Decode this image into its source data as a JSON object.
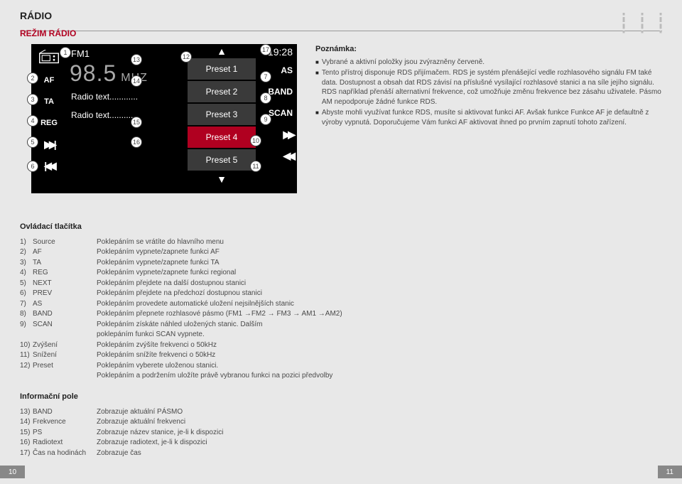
{
  "header": {
    "title": "RÁDIO"
  },
  "section": {
    "mode_title": "REŽIM RÁDIO"
  },
  "radio": {
    "band": "FM1",
    "frequency": "98.5",
    "unit": "MHZ",
    "time": "19:28",
    "af": "AF",
    "ta": "TA",
    "reg": "REG",
    "as": "AS",
    "band_btn": "BAND",
    "scan": "SCAN",
    "radiotext1": "Radio text............",
    "radiotext2": "Radio text............",
    "presets": [
      "Preset 1",
      "Preset 2",
      "Preset 3",
      "Preset 4",
      "Preset 5"
    ]
  },
  "callouts": [
    "1",
    "2",
    "3",
    "4",
    "5",
    "6",
    "7",
    "8",
    "9",
    "10",
    "11",
    "12",
    "13",
    "14",
    "15",
    "16",
    "17"
  ],
  "notes": {
    "title": "Poznámka:",
    "items": [
      "Vybrané a aktivní položky jsou zvýrazněny červeně.",
      "Tento přístroj disponuje RDS přijímačem. RDS je systém přenášející vedle rozhlasového signálu FM také data. Dostupnost a obsah dat RDS závisí na příslušné vysílající rozhlasové stanici a na síle jejího signálu. RDS například přenáší alternativní frekvence, což umožňuje změnu frekvence bez zásahu uživatele. Pásmo AM nepodporuje žádné funkce RDS.",
      "Abyste mohli využívat funkce RDS, musíte si aktivovat funkci AF. Avšak funkce Funkce AF je defaultně z výroby vypnutá. Doporučujeme Vám funkci AF aktivovat ihned po prvním zapnutí tohoto zařízení."
    ]
  },
  "controls": {
    "title": "Ovládací tlačítka",
    "rows": [
      {
        "n": "1)",
        "name": "Source",
        "desc": "Poklepáním se vrátíte do hlavního menu"
      },
      {
        "n": "2)",
        "name": "AF",
        "desc": "Poklepáním vypnete/zapnete funkci AF"
      },
      {
        "n": "3)",
        "name": "TA",
        "desc": "Poklepáním vypnete/zapnete funkci TA"
      },
      {
        "n": "4)",
        "name": "REG",
        "desc": "Poklepáním vypnete/zapnete funkci regional"
      },
      {
        "n": "5)",
        "name": "NEXT",
        "desc": "Poklepáním přejdete na další dostupnou stanici"
      },
      {
        "n": "6)",
        "name": "PREV",
        "desc": "Poklepáním přejdete na předchozí dostupnou stanici"
      },
      {
        "n": "7)",
        "name": "AS",
        "desc": "Poklepáním provedete automatické uložení nejsilnějších stanic"
      },
      {
        "n": "8)",
        "name": "BAND",
        "desc": "Poklepáním přepnete rozhlasové pásmo (FM1 →FM2 → FM3 → AM1 →AM2)"
      },
      {
        "n": "9)",
        "name": "SCAN",
        "desc": "Poklepáním získáte náhled uložených stanic. Dalším"
      },
      {
        "n": "",
        "name": "",
        "desc": "poklepáním funkci SCAN vypnete."
      },
      {
        "n": "10)",
        "name": "Zvýšení",
        "desc": "Poklepáním zvýšíte frekvenci o 50kHz"
      },
      {
        "n": "11)",
        "name": "Snížení",
        "desc": "Poklepáním snížíte frekvenci o 50kHz"
      },
      {
        "n": "12)",
        "name": "Preset",
        "desc": "Poklepáním vyberete uloženou stanici."
      },
      {
        "n": "",
        "name": "",
        "desc": "Poklepáním a podržením uložíte právě vybranou funkci na pozici předvolby"
      }
    ]
  },
  "info": {
    "title": "Informační pole",
    "rows": [
      {
        "n": "13)",
        "name": "BAND",
        "desc": "Zobrazuje aktuální PÁSMO"
      },
      {
        "n": "14)",
        "name": "Frekvence",
        "desc": "Zobrazuje aktuální frekvenci"
      },
      {
        "n": "15)",
        "name": "PS",
        "desc": "Zobrazuje název stanice, je-li k dispozici"
      },
      {
        "n": "16)",
        "name": "Radiotext",
        "desc": "Zobrazuje radiotext, je-li k dispozici"
      },
      {
        "n": "17)",
        "name": "Čas na hodinách",
        "desc": "Zobrazuje čas"
      }
    ]
  },
  "pagenum": {
    "left": "10",
    "right": "11"
  }
}
